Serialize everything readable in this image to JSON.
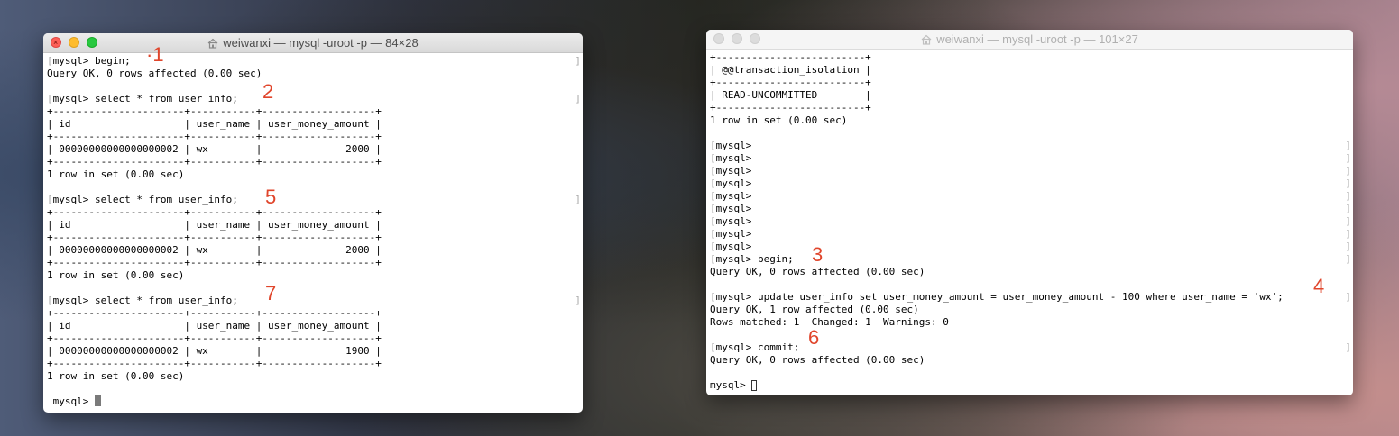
{
  "left_window": {
    "title": "weiwanxi — mysql -uroot -p — 84×28",
    "lines": [
      "[mysql> begin;",
      "Query OK, 0 rows affected (0.00 sec)",
      "",
      "[mysql> select * from user_info;",
      "+----------------------+-----------+-------------------+",
      "| id                   | user_name | user_money_amount |",
      "+----------------------+-----------+-------------------+",
      "| 00000000000000000002 | wx        |              2000 |",
      "+----------------------+-----------+-------------------+",
      "1 row in set (0.00 sec)",
      "",
      "[mysql> select * from user_info;",
      "+----------------------+-----------+-------------------+",
      "| id                   | user_name | user_money_amount |",
      "+----------------------+-----------+-------------------+",
      "| 00000000000000000002 | wx        |              2000 |",
      "+----------------------+-----------+-------------------+",
      "1 row in set (0.00 sec)",
      "",
      "[mysql> select * from user_info;",
      "+----------------------+-----------+-------------------+",
      "| id                   | user_name | user_money_amount |",
      "+----------------------+-----------+-------------------+",
      "| 00000000000000000002 | wx        |              1900 |",
      "+----------------------+-----------+-------------------+",
      "1 row in set (0.00 sec)",
      "",
      " mysql> "
    ]
  },
  "right_window": {
    "title": "weiwanxi — mysql -uroot -p — 101×27",
    "lines": [
      "+-------------------------+",
      "| @@transaction_isolation |",
      "+-------------------------+",
      "| READ-UNCOMMITTED        |",
      "+-------------------------+",
      "1 row in set (0.00 sec)",
      "",
      "[mysql>",
      "[mysql>",
      "[mysql>",
      "[mysql>",
      "[mysql>",
      "[mysql>",
      "[mysql>",
      "[mysql>",
      "[mysql>",
      "[mysql> begin;",
      "Query OK, 0 rows affected (0.00 sec)",
      "",
      "[mysql> update user_info set user_money_amount = user_money_amount - 100 where user_name = 'wx';",
      "Query OK, 1 row affected (0.00 sec)",
      "Rows matched: 1  Changed: 1  Warnings: 0",
      "",
      "[mysql> commit;",
      "Query OK, 0 rows affected (0.00 sec)",
      "",
      "mysql> "
    ]
  },
  "annotations": {
    "a1": "·1",
    "a2": "2",
    "a3": "3",
    "a4": "4",
    "a5": "5",
    "a6": "6",
    "a7": "7"
  },
  "colors": {
    "annotation": "#e0452b",
    "close": "#fd5f57",
    "minimize": "#febc2e",
    "zoom": "#28c840"
  }
}
